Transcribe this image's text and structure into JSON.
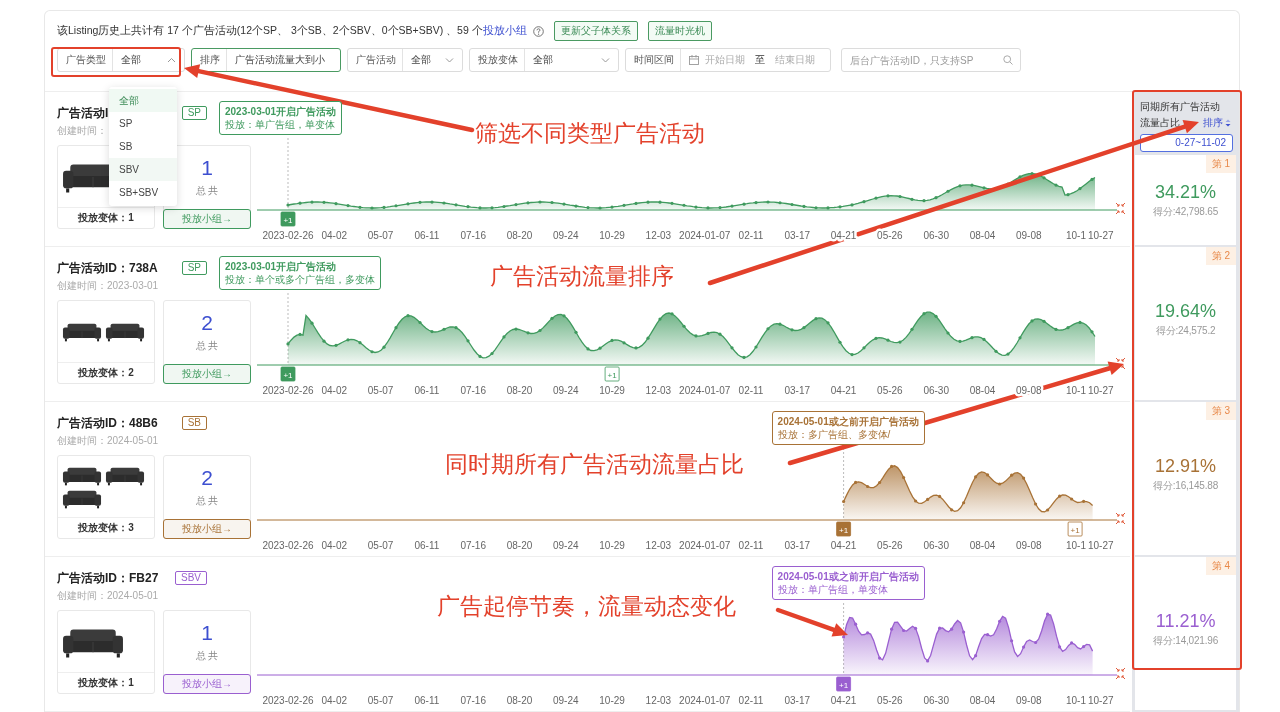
{
  "summary": {
    "text": "该Listing历史上共计有 17 个广告活动(12个SP、 3个SB、2个SBV、0个SB+SBV) 、59 个",
    "link": "投放小组"
  },
  "header_buttons": [
    "更新父子体关系",
    "流量时光机"
  ],
  "filters": [
    {
      "kind": "select",
      "label": "广告类型",
      "value": "全部",
      "expanded": true,
      "active": false,
      "options": [
        {
          "label": "全部",
          "selected": true,
          "hovered": false
        },
        {
          "label": "SP",
          "selected": false,
          "hovered": false
        },
        {
          "label": "SB",
          "selected": false,
          "hovered": false
        },
        {
          "label": "SBV",
          "selected": false,
          "hovered": true
        },
        {
          "label": "SB+SBV",
          "selected": false,
          "hovered": false
        }
      ]
    },
    {
      "kind": "select",
      "label": "排序",
      "value": "广告活动流量大到小",
      "expanded": false,
      "active": true
    },
    {
      "kind": "select",
      "label": "广告活动",
      "value": "全部",
      "expanded": false,
      "active": false
    },
    {
      "kind": "select",
      "label": "投放变体",
      "value": "全部",
      "expanded": false,
      "active": false
    },
    {
      "kind": "daterange",
      "label": "时间区间",
      "start_placeholder": "开始日期",
      "separator": "至",
      "end_placeholder": "结束日期"
    },
    {
      "kind": "search",
      "placeholder": "后台广告活动ID，只支持SP"
    }
  ],
  "campaigns": [
    {
      "title": "广告活动I",
      "tag": "SP",
      "color": "#3f9a5e",
      "created": "创建时间：",
      "variants": "投放变体：1",
      "count": "1",
      "count_label": "总 共",
      "group_button": "投放小组→",
      "callout": {
        "title": "2023-03-01开启广告活动",
        "text": "投放：单广告组，单变体"
      },
      "x_labels": [
        {
          "text": "2023-02-26",
          "marker": {
            "text": "+1",
            "filled": true
          }
        },
        {
          "text": "04-02"
        },
        {
          "text": "05-07"
        },
        {
          "text": "06-11"
        },
        {
          "text": "07-16"
        },
        {
          "text": "08-20"
        },
        {
          "text": "09-24"
        },
        {
          "text": "10-29"
        },
        {
          "text": "12-03"
        },
        {
          "text": "2024-01-07"
        },
        {
          "text": "02-11"
        },
        {
          "text": "03-17"
        },
        {
          "text": "04-21"
        },
        {
          "text": "05-26"
        },
        {
          "text": "06-30"
        },
        {
          "text": "08-04"
        },
        {
          "text": "09-08"
        },
        {
          "text": "10-1"
        },
        {
          "text": "10-27"
        }
      ]
    },
    {
      "title": "广告活动ID：738A",
      "tag": "SP",
      "color": "#3f9a5e",
      "created": "创建时间：2023-03-01",
      "variants": "投放变体：2",
      "count": "2",
      "count_label": "总 共",
      "group_button": "投放小组→",
      "callout": {
        "title": "2023-03-01开启广告活动",
        "text": "投放：单个或多个广告组，多变体"
      },
      "x_labels": [
        {
          "text": "2023-02-26",
          "marker": {
            "text": "+1",
            "filled": true
          }
        },
        {
          "text": "04-02"
        },
        {
          "text": "05-07"
        },
        {
          "text": "06-11"
        },
        {
          "text": "07-16"
        },
        {
          "text": "08-20"
        },
        {
          "text": "09-24"
        },
        {
          "text": "10-29",
          "marker": {
            "text": "+1",
            "filled": false
          }
        },
        {
          "text": "12-03"
        },
        {
          "text": "2024-01-07"
        },
        {
          "text": "02-11"
        },
        {
          "text": "03-17"
        },
        {
          "text": "04-21"
        },
        {
          "text": "05-26"
        },
        {
          "text": "06-30"
        },
        {
          "text": "08-04"
        },
        {
          "text": "09-08"
        },
        {
          "text": "10-1"
        },
        {
          "text": "10-27"
        }
      ]
    },
    {
      "title": "广告活动ID：48B6",
      "tag": "SB",
      "color": "#a87236",
      "created": "创建时间：2024-05-01",
      "variants": "投放变体：3",
      "count": "2",
      "count_label": "总 共",
      "group_button": "投放小组→",
      "callout": {
        "title": "2024-05-01或之前开启广告活动",
        "text": "投放：多广告组、多变体/"
      },
      "x_labels": [
        {
          "text": "2023-02-26"
        },
        {
          "text": "04-02"
        },
        {
          "text": "05-07"
        },
        {
          "text": "06-11"
        },
        {
          "text": "07-16"
        },
        {
          "text": "08-20"
        },
        {
          "text": "09-24"
        },
        {
          "text": "10-29"
        },
        {
          "text": "12-03"
        },
        {
          "text": "2024-01-07"
        },
        {
          "text": "02-11"
        },
        {
          "text": "03-17"
        },
        {
          "text": "04-21",
          "marker": {
            "text": "+1",
            "filled": true
          }
        },
        {
          "text": "05-26"
        },
        {
          "text": "06-30"
        },
        {
          "text": "08-04"
        },
        {
          "text": "09-08"
        },
        {
          "text": "10-1",
          "marker": {
            "text": "+1",
            "filled": false
          }
        },
        {
          "text": "10-27"
        }
      ]
    },
    {
      "title": "广告活动ID：FB27",
      "tag": "SBV",
      "color": "#9a5fd0",
      "created": "创建时间：2024-05-01",
      "variants": "投放变体：1",
      "count": "1",
      "count_label": "总 共",
      "group_button": "投放小组→",
      "callout": {
        "title": "2024-05-01或之前开启广告活动",
        "text": "投放：单广告组，单变体"
      },
      "x_labels": [
        {
          "text": "2023-02-26"
        },
        {
          "text": "04-02"
        },
        {
          "text": "05-07"
        },
        {
          "text": "06-11"
        },
        {
          "text": "07-16"
        },
        {
          "text": "08-20"
        },
        {
          "text": "09-24"
        },
        {
          "text": "10-29"
        },
        {
          "text": "12-03"
        },
        {
          "text": "2024-01-07"
        },
        {
          "text": "02-11"
        },
        {
          "text": "03-17"
        },
        {
          "text": "04-21",
          "marker": {
            "text": "+1",
            "filled": true
          }
        },
        {
          "text": "05-26"
        },
        {
          "text": "06-30"
        },
        {
          "text": "08-04"
        },
        {
          "text": "09-08"
        },
        {
          "text": "10-1"
        },
        {
          "text": "10-27"
        }
      ]
    }
  ],
  "share_panel": {
    "title": "同期所有广告活动",
    "subtitle": "流量占比",
    "sort_link": "排序",
    "date_range": "0-27~11-02",
    "items": [
      {
        "rank": "第 1",
        "percent": "34.21%",
        "score": "得分:42,798.65",
        "color": "#3f9a5e"
      },
      {
        "rank": "第 2",
        "percent": "19.64%",
        "score": "得分:24,575.2",
        "color": "#3f9a5e"
      },
      {
        "rank": "第 3",
        "percent": "12.91%",
        "score": "得分:16,145.88",
        "color": "#a87236"
      },
      {
        "rank": "第 4",
        "percent": "11.21%",
        "score": "得分:14,021.96",
        "color": "#9a5fd0"
      }
    ]
  },
  "annotations": [
    {
      "kind": "box"
    },
    {
      "kind": "box"
    },
    {
      "kind": "arrow_label",
      "text": "筛选不同类型广告活动"
    },
    {
      "kind": "arrow_label",
      "text": "广告活动流量排序"
    },
    {
      "kind": "arrow_label",
      "text": "同时期所有广告活动流量占比"
    },
    {
      "kind": "arrow_label",
      "text": "广告起停节奏，流量动态变化"
    }
  ]
}
